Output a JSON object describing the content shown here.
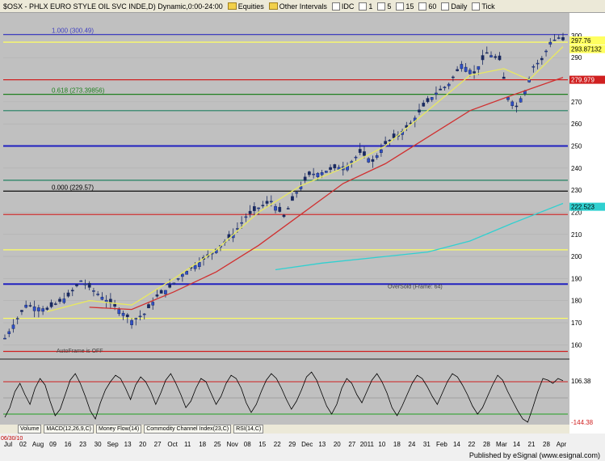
{
  "toolbar": {
    "symbol": "$OSX - PHLX EURO STYLE OIL SVC INDE,D) Dynamic,0:00-24:00",
    "items": [
      "Equities",
      "Other Intervals",
      "IDC",
      "1",
      "5",
      "15",
      "60",
      "Daily",
      "Tick"
    ]
  },
  "chart_data": [
    {
      "type": "candlestick",
      "symbol": "$OSX - PHLX EURO STYLE OIL SVC INDE,D) Dynamic,0:00-24:00",
      "ylim": [
        155,
        304
      ],
      "y_ticks": [
        160,
        170,
        180,
        190,
        200,
        210,
        220,
        230,
        240,
        250,
        260,
        270,
        280,
        290,
        300
      ],
      "x_ticks": [
        "Jul",
        "02",
        "Aug",
        "09",
        "16",
        "23",
        "30",
        "Sep",
        "13",
        "20",
        "27",
        "Oct",
        "11",
        "18",
        "25",
        "Nov",
        "08",
        "15",
        "22",
        "29",
        "Dec",
        "13",
        "20",
        "27",
        "2011",
        "10",
        "18",
        "24",
        "31",
        "Feb",
        "14",
        "22",
        "28",
        "Mar",
        "14",
        "21",
        "28",
        "Apr"
      ],
      "start_date_label": "06/30/10",
      "price_path": [
        [
          0,
          163
        ],
        [
          5,
          178
        ],
        [
          10,
          176
        ],
        [
          15,
          182
        ],
        [
          18,
          189
        ],
        [
          22,
          183
        ],
        [
          27,
          176
        ],
        [
          30,
          171
        ],
        [
          33,
          174
        ],
        [
          36,
          182
        ],
        [
          39,
          186
        ],
        [
          42,
          192
        ],
        [
          45,
          196
        ],
        [
          48,
          200
        ],
        [
          51,
          205
        ],
        [
          54,
          210
        ],
        [
          57,
          218
        ],
        [
          60,
          222
        ],
        [
          63,
          225
        ],
        [
          66,
          218
        ],
        [
          69,
          229
        ],
        [
          72,
          237
        ],
        [
          75,
          238
        ],
        [
          78,
          240
        ],
        [
          81,
          241
        ],
        [
          84,
          247
        ],
        [
          87,
          243
        ],
        [
          90,
          251
        ],
        [
          93,
          255
        ],
        [
          96,
          260
        ],
        [
          99,
          268
        ],
        [
          102,
          274
        ],
        [
          105,
          278
        ],
        [
          108,
          287
        ],
        [
          111,
          283
        ],
        [
          114,
          292
        ],
        [
          117,
          289
        ],
        [
          119,
          272
        ],
        [
          121,
          268
        ],
        [
          123,
          275
        ],
        [
          125,
          286
        ],
        [
          127,
          289
        ],
        [
          129,
          297
        ],
        [
          131,
          299
        ],
        [
          132,
          298
        ]
      ],
      "moving_averages": [
        {
          "color": "#e8e860",
          "path": [
            [
              10,
              175
            ],
            [
              20,
              180
            ],
            [
              30,
              178
            ],
            [
              40,
              190
            ],
            [
              50,
              203
            ],
            [
              60,
              220
            ],
            [
              70,
              232
            ],
            [
              80,
              240
            ],
            [
              90,
              250
            ],
            [
              100,
              266
            ],
            [
              110,
              282
            ],
            [
              118,
              285
            ],
            [
              124,
              280
            ],
            [
              132,
              295
            ]
          ]
        },
        {
          "color": "#d03030",
          "path": [
            [
              20,
              177
            ],
            [
              30,
              176
            ],
            [
              40,
              184
            ],
            [
              50,
              193
            ],
            [
              60,
              205
            ],
            [
              70,
              219
            ],
            [
              80,
              233
            ],
            [
              90,
              242
            ],
            [
              100,
              254
            ],
            [
              110,
              266
            ],
            [
              120,
              273
            ],
            [
              132,
              281
            ]
          ]
        },
        {
          "color": "#30d0d0",
          "path": [
            [
              64,
              194
            ],
            [
              75,
              197
            ],
            [
              90,
              200
            ],
            [
              100,
              202
            ],
            [
              110,
              207
            ],
            [
              120,
              215
            ],
            [
              132,
              224
            ]
          ]
        }
      ],
      "horizontal_lines": [
        {
          "value": 300.49,
          "color": "#4040c0",
          "label": "1.000 (300.49)"
        },
        {
          "value": 297.0,
          "color": "#ffff60",
          "label": ""
        },
        {
          "value": 279.979,
          "color": "#d02020",
          "label": ""
        },
        {
          "value": 273.39856,
          "color": "#208020",
          "label": "0.618 (273.39856)"
        },
        {
          "value": 266.0,
          "color": "#208060",
          "label": ""
        },
        {
          "value": 250.0,
          "color": "#2020c0",
          "label": ""
        },
        {
          "value": 234.5,
          "color": "#208060",
          "label": ""
        },
        {
          "value": 229.57,
          "color": "#000000",
          "label": "0.000 (229.57)"
        },
        {
          "value": 219.0,
          "color": "#d02020",
          "label": ""
        },
        {
          "value": 203.0,
          "color": "#ffff60",
          "label": ""
        },
        {
          "value": 187.5,
          "color": "#2020c0",
          "label": ""
        },
        {
          "value": 172.0,
          "color": "#ffff60",
          "label": ""
        },
        {
          "value": 157.0,
          "color": "#d02020",
          "label": ""
        }
      ],
      "price_labels": [
        {
          "value": 297.76,
          "bg": "#ffff60",
          "text": "297.76"
        },
        {
          "value": 293.87,
          "bg": "#ffff60",
          "text": "293.87132"
        },
        {
          "value": 279.979,
          "bg": "#d02020",
          "text": "279.979"
        },
        {
          "value": 222.5,
          "bg": "#30d0d0",
          "text": "222.523"
        }
      ],
      "annotations": [
        "OverSold (Frame: 64)",
        "AutoFrame is OFF"
      ]
    },
    {
      "type": "line",
      "name": "Commodity Channel Index(23,C)",
      "ylim": [
        -160,
        220
      ],
      "reference_lines": [
        100,
        0,
        -100
      ],
      "last_value_label": "106.38",
      "low_value_label": "-144.38",
      "values": [
        -120,
        -60,
        40,
        90,
        20,
        -40,
        60,
        120,
        80,
        -20,
        -110,
        -70,
        20,
        110,
        150,
        90,
        10,
        -80,
        -130,
        -30,
        50,
        100,
        140,
        120,
        60,
        -10,
        80,
        130,
        100,
        40,
        -40,
        30,
        110,
        150,
        90,
        20,
        -60,
        -20,
        60,
        120,
        100,
        30,
        -40,
        10,
        90,
        140,
        120,
        60,
        -30,
        -90,
        -40,
        40,
        110,
        150,
        120,
        60,
        -10,
        -70,
        -20,
        50,
        130,
        160,
        110,
        30,
        -50,
        -100,
        -40,
        60,
        120,
        90,
        20,
        -30,
        40,
        110,
        150,
        100,
        30,
        -60,
        -110,
        -50,
        20,
        90,
        140,
        120,
        70,
        10,
        -40,
        30,
        100,
        150,
        130,
        80,
        20,
        -50,
        -100,
        -60,
        10,
        80,
        140,
        110,
        40,
        -20,
        -80,
        -130,
        -150,
        -60,
        40,
        120,
        110,
        90,
        120,
        106
      ]
    }
  ],
  "bottom_tabs": [
    "Volume",
    "MACD(12,26,9,C)",
    "Money Flow(14)",
    "Commodity Channel Index(23,C)",
    "RSI(14,C)"
  ],
  "footer": "Published by eSignal (www.esignal.com)"
}
